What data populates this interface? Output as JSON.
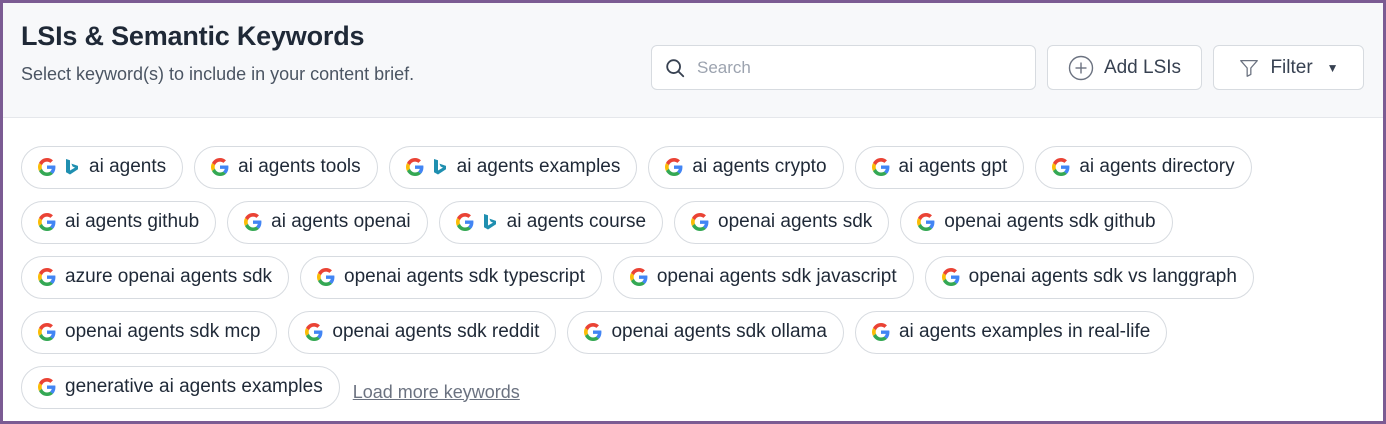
{
  "header": {
    "title": "LSIs & Semantic Keywords",
    "subtitle": "Select keyword(s) to include in your content brief.",
    "search_placeholder": "Search",
    "add_label": "Add LSIs",
    "filter_label": "Filter"
  },
  "colors": {
    "frame": "#7b5b93",
    "google_blue": "#4285F4",
    "google_red": "#EA4335",
    "google_yellow": "#FBBC05",
    "google_green": "#34A853",
    "bing_teal": "#1f8fb0"
  },
  "keyword_rows": [
    [
      {
        "label": "ai agents",
        "engines": [
          "google-icon",
          "bing-icon"
        ]
      },
      {
        "label": "ai agents tools",
        "engines": [
          "google-icon"
        ]
      },
      {
        "label": "ai agents examples",
        "engines": [
          "google-icon",
          "bing-icon"
        ]
      },
      {
        "label": "ai agents crypto",
        "engines": [
          "google-icon"
        ]
      },
      {
        "label": "ai agents gpt",
        "engines": [
          "google-icon"
        ]
      },
      {
        "label": "ai agents directory",
        "engines": [
          "google-icon"
        ]
      }
    ],
    [
      {
        "label": "ai agents github",
        "engines": [
          "google-icon"
        ]
      },
      {
        "label": "ai agents openai",
        "engines": [
          "google-icon"
        ]
      },
      {
        "label": "ai agents course",
        "engines": [
          "google-icon",
          "bing-icon"
        ]
      },
      {
        "label": "openai agents sdk",
        "engines": [
          "google-icon"
        ]
      },
      {
        "label": "openai agents sdk github",
        "engines": [
          "google-icon"
        ]
      }
    ],
    [
      {
        "label": "azure openai agents sdk",
        "engines": [
          "google-icon"
        ]
      },
      {
        "label": "openai agents sdk typescript",
        "engines": [
          "google-icon"
        ]
      },
      {
        "label": "openai agents sdk javascript",
        "engines": [
          "google-icon"
        ]
      },
      {
        "label": "openai agents sdk vs langgraph",
        "engines": [
          "google-icon"
        ]
      }
    ],
    [
      {
        "label": "openai agents sdk mcp",
        "engines": [
          "google-icon"
        ]
      },
      {
        "label": "openai agents sdk reddit",
        "engines": [
          "google-icon"
        ]
      },
      {
        "label": "openai agents sdk ollama",
        "engines": [
          "google-icon"
        ]
      },
      {
        "label": "ai agents examples in real-life",
        "engines": [
          "google-icon"
        ]
      }
    ],
    [
      {
        "label": "generative ai agents examples",
        "engines": [
          "google-icon"
        ]
      }
    ]
  ],
  "load_more_label": "Load more keywords"
}
